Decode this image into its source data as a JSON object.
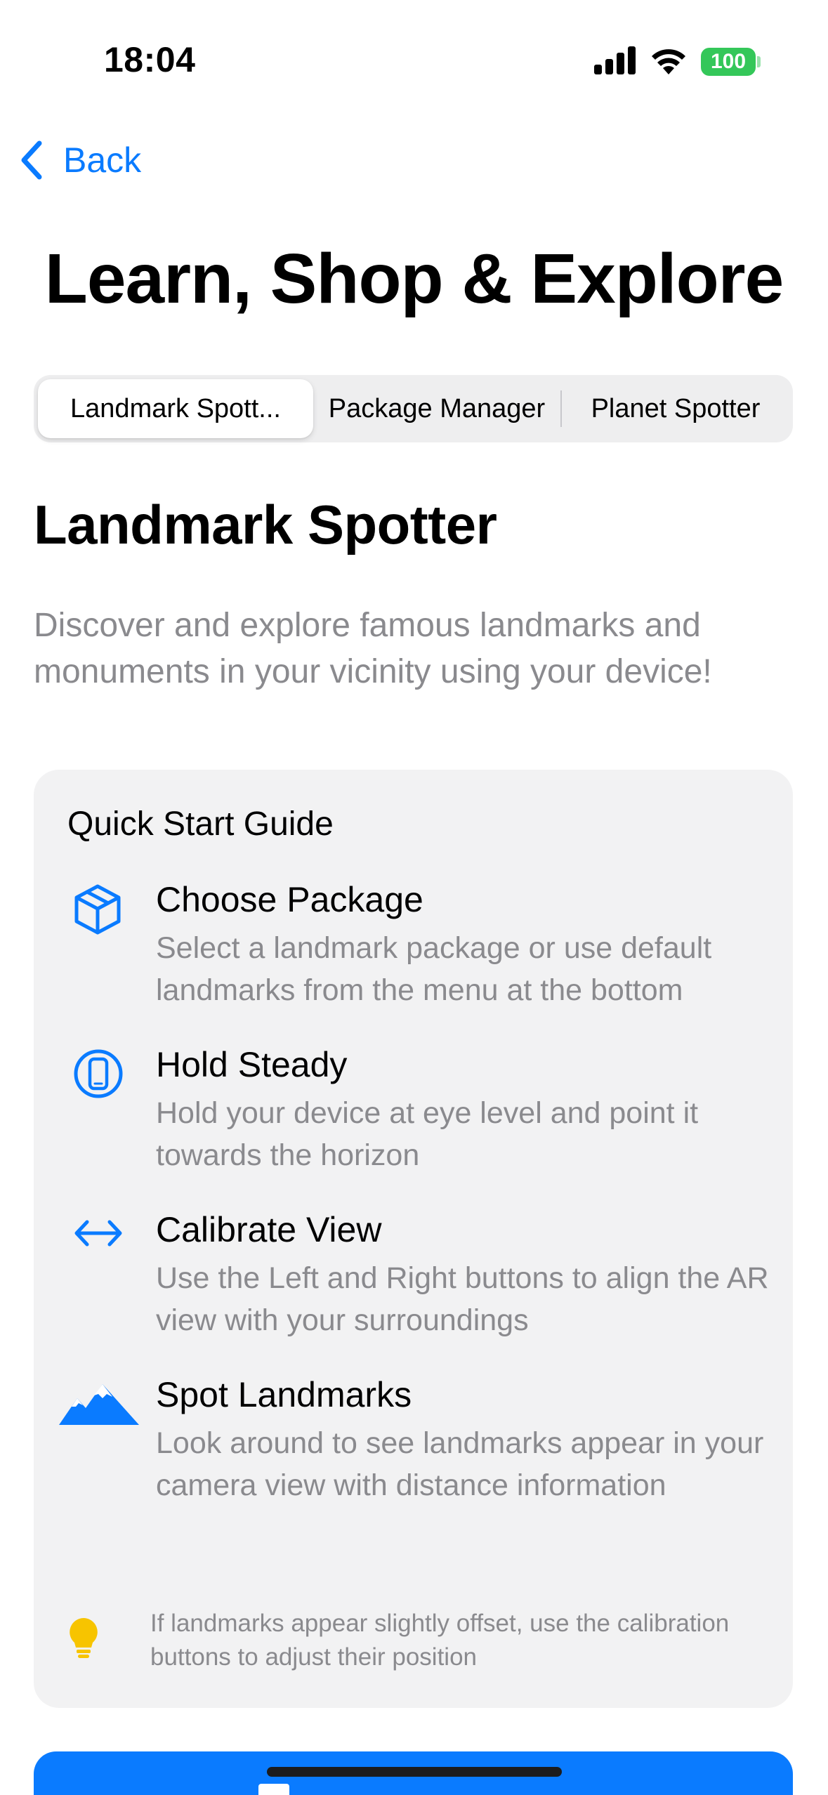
{
  "status_bar": {
    "time": "18:04",
    "battery": "100",
    "icons": [
      "signal-icon",
      "wifi-icon",
      "battery-icon"
    ]
  },
  "nav": {
    "back_label": "Back",
    "back_icon": "chevron-left-icon"
  },
  "page": {
    "title": "Learn, Shop & Explore"
  },
  "tabs": [
    {
      "label": "Landmark Spott...",
      "selected": true
    },
    {
      "label": "Package Manager",
      "selected": false
    },
    {
      "label": "Planet Spotter",
      "selected": false
    }
  ],
  "section": {
    "title": "Landmark Spotter",
    "description": "Discover and explore famous landmarks and monuments in your vicinity using your device!"
  },
  "guide": {
    "title": "Quick Start Guide",
    "steps": [
      {
        "icon": "cube-icon",
        "title": "Choose Package",
        "description": "Select a landmark package or use default landmarks from the menu at the bottom"
      },
      {
        "icon": "phone-circle-icon",
        "title": "Hold Steady",
        "description": "Hold your device at eye level and point it towards the horizon"
      },
      {
        "icon": "left-right-arrow-icon",
        "title": "Calibrate View",
        "description": "Use the Left and Right buttons to align the AR view with your surroundings"
      },
      {
        "icon": "mountains-icon",
        "title": "Spot Landmarks",
        "description": "Look around to see landmarks appear in your camera view with distance information"
      }
    ],
    "tip": {
      "icon": "lightbulb-icon",
      "text": "If landmarks appear slightly offset, use the calibration buttons to adjust their position"
    }
  },
  "colors": {
    "accent": "#0a7bff",
    "secondary_text": "#8a8a8e",
    "card_background": "#f2f2f3",
    "battery": "#34c759",
    "tip_icon": "#f7c400"
  }
}
